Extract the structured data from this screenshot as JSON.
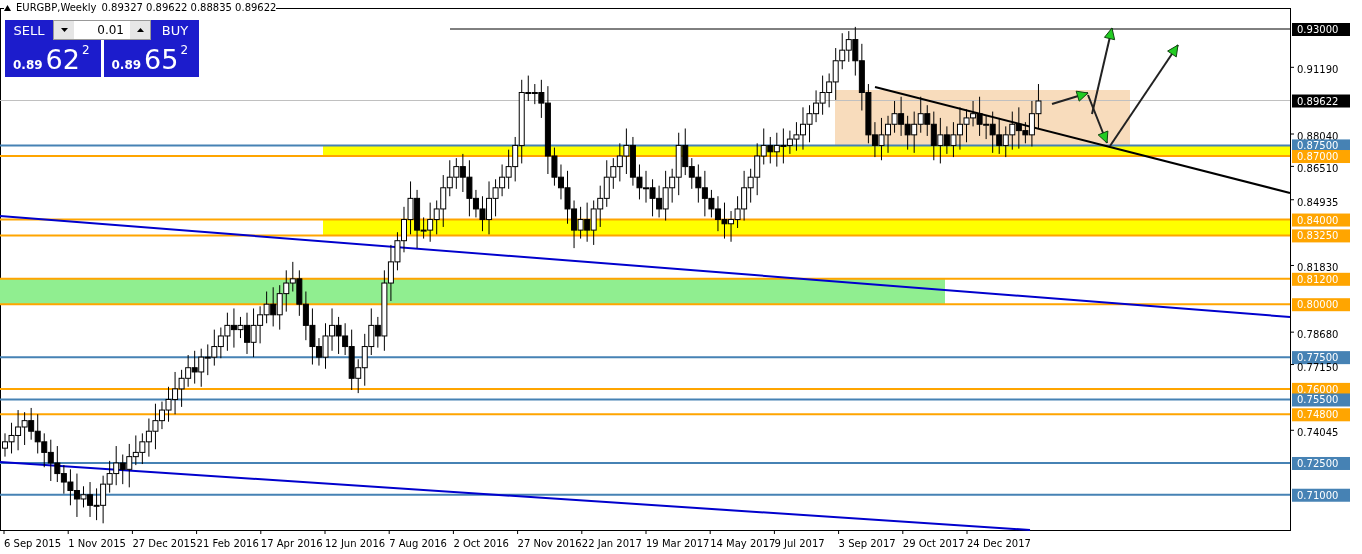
{
  "chart_header": {
    "symbol": "EURGBP,Weekly",
    "ohlc": "0.89327 0.89622 0.88835 0.89622"
  },
  "trade_panel": {
    "sell": {
      "label": "SELL",
      "price_prefix": "0.89",
      "price_main": "62",
      "price_sup": "2"
    },
    "buy": {
      "label": "BUY",
      "price_prefix": "0.89",
      "price_main": "65",
      "price_sup": "2"
    },
    "lot": "0.01"
  },
  "price_axis": [
    {
      "label": "0.93000",
      "kind": "marker",
      "color": "#000000"
    },
    {
      "label": "0.91190",
      "kind": "tick"
    },
    {
      "label": "0.89622",
      "kind": "current",
      "color": "#000000"
    },
    {
      "label": "0.88040",
      "kind": "tick"
    },
    {
      "label": "0.87500",
      "kind": "level",
      "color": "#4682b4"
    },
    {
      "label": "0.87000",
      "kind": "level",
      "color": "#ffa500"
    },
    {
      "label": "0.86510",
      "kind": "tick"
    },
    {
      "label": "0.84935",
      "kind": "tick"
    },
    {
      "label": "0.84000",
      "kind": "level",
      "color": "#ffa500"
    },
    {
      "label": "0.83250",
      "kind": "level",
      "color": "#ffa500"
    },
    {
      "label": "0.81830",
      "kind": "tick"
    },
    {
      "label": "0.81200",
      "kind": "level",
      "color": "#ffa500"
    },
    {
      "label": "0.80000",
      "kind": "level",
      "color": "#ffa500"
    },
    {
      "label": "0.78680",
      "kind": "tick"
    },
    {
      "label": "0.77500",
      "kind": "level",
      "color": "#4682b4"
    },
    {
      "label": "0.77150",
      "kind": "tick"
    },
    {
      "label": "0.76000",
      "kind": "level",
      "color": "#ffa500"
    },
    {
      "label": "0.75500",
      "kind": "level",
      "color": "#4682b4"
    },
    {
      "label": "0.74800",
      "kind": "level",
      "color": "#ffa500"
    },
    {
      "label": "0.74045",
      "kind": "tick"
    },
    {
      "label": "0.72500",
      "kind": "level",
      "color": "#4682b4"
    },
    {
      "label": "0.71000",
      "kind": "level",
      "color": "#4682b4"
    }
  ],
  "time_axis": [
    "6 Sep 2015",
    "1 Nov 2015",
    "27 Dec 2015",
    "21 Feb 2016",
    "17 Apr 2016",
    "12 Jun 2016",
    "7 Aug 2016",
    "2 Oct 2016",
    "27 Nov 2016",
    "22 Jan 2017",
    "19 Mar 2017",
    "14 May 2017",
    "9 Jul 2017",
    "3 Sep 2017",
    "29 Oct 2017",
    "24 Dec 2017"
  ]
}
